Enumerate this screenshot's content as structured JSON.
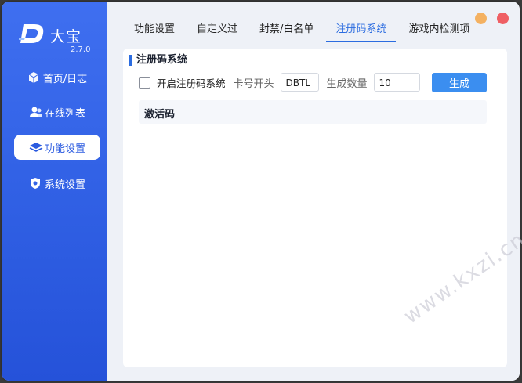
{
  "app": {
    "name": "大宝",
    "version": "2.7.0"
  },
  "sidebar": {
    "items": [
      {
        "label": "首页/日志",
        "icon": "cube-icon",
        "active": false
      },
      {
        "label": "在线列表",
        "icon": "users-icon",
        "active": false
      },
      {
        "label": "功能设置",
        "icon": "layers-icon",
        "active": true
      },
      {
        "label": "系统设置",
        "icon": "shield-gear-icon",
        "active": false
      }
    ]
  },
  "tabs": [
    {
      "label": "功能设置",
      "active": false
    },
    {
      "label": "自定义过",
      "active": false
    },
    {
      "label": "封禁/白名单",
      "active": false
    },
    {
      "label": "注册码系统",
      "active": true
    },
    {
      "label": "游戏内检测项",
      "active": false
    }
  ],
  "panel": {
    "title": "注册码系统",
    "enable_label": "开启注册码系统",
    "enabled": false,
    "prefix_label": "卡号开头",
    "prefix_value": "DBTL",
    "count_label": "生成数量",
    "count_value": "10",
    "generate_label": "生成",
    "codes_header": "激活码"
  },
  "watermark": "www.kxzi.cn",
  "colors": {
    "accent": "#2b6ce0",
    "sidebar": "#3262e6",
    "button": "#3b8ef0",
    "minimize": "#f4b161",
    "close": "#ef5f64"
  }
}
